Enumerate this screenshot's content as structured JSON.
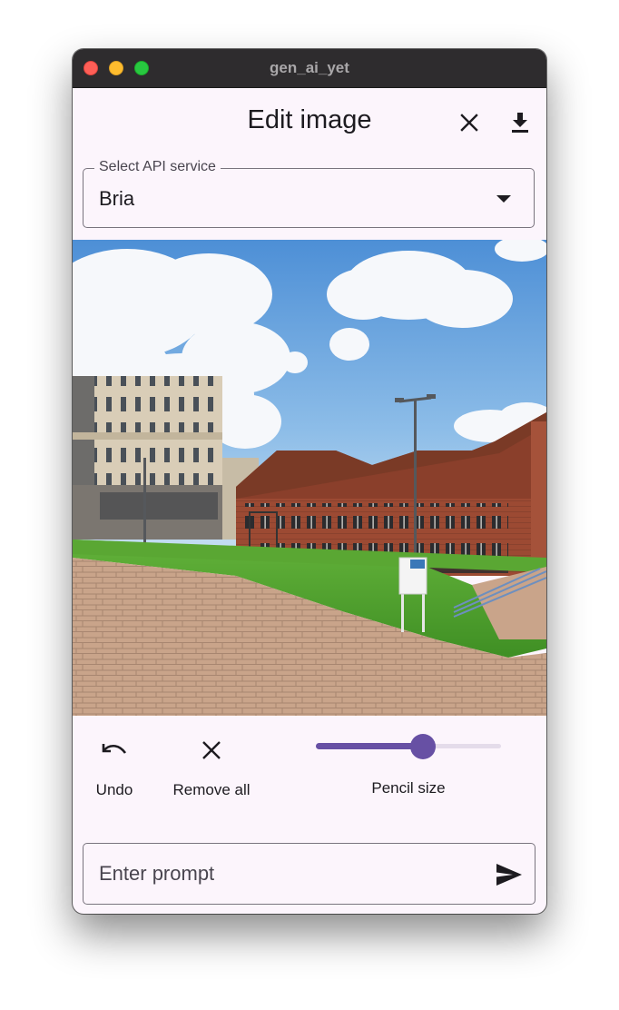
{
  "window": {
    "title": "gen_ai_yet"
  },
  "appbar": {
    "title": "Edit image",
    "close_icon": "close-icon",
    "download_icon": "download-icon"
  },
  "api_select": {
    "label": "Select API service",
    "value": "Bria"
  },
  "image": {
    "description_icon": "photo"
  },
  "tools": {
    "undo_label": "Undo",
    "remove_all_label": "Remove all",
    "pencil_size_label": "Pencil size",
    "pencil_size_fraction": 0.58
  },
  "prompt": {
    "placeholder": "Enter prompt",
    "value": ""
  },
  "colors": {
    "accent": "#6750a4",
    "background": "#fcf5fc",
    "titlebar": "#2e2c2e"
  }
}
